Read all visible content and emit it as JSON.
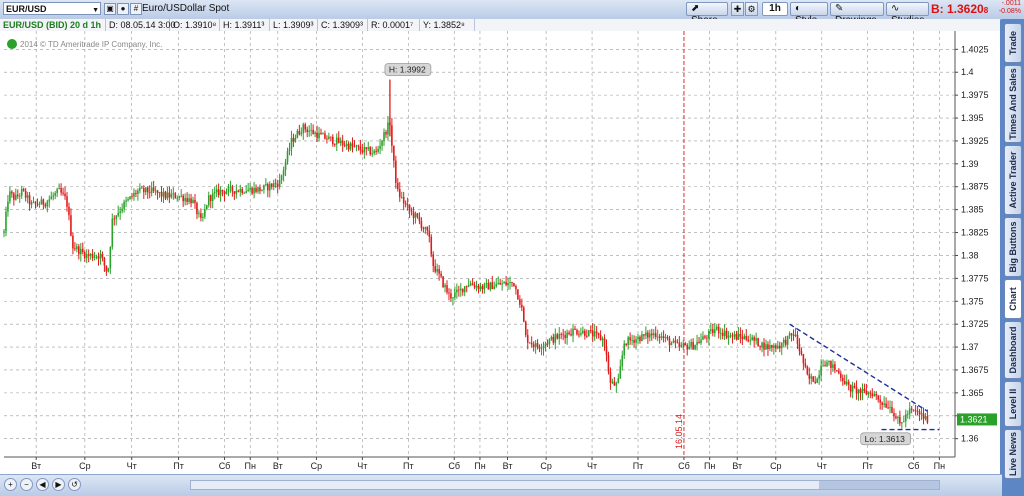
{
  "toolbar": {
    "symbol": "EUR/USD",
    "description": "Euro/USDollar Spot",
    "share_label": "Share",
    "timeframe_label": "1h",
    "style_label": "Style",
    "drawings_label": "Drawings",
    "studies_label": "Studies",
    "bid_label": "B: 1.3620",
    "bid_suffix": "8",
    "change_abs": "-.0011",
    "change_pct": "-0.08%"
  },
  "infobar": {
    "title": "EUR/USD (BID) 20 d 1h",
    "date": "D: 08.05.14 3:00",
    "open": "O: 1.3910⁸",
    "high": "H: 1.3911³",
    "low": "L: 1.3909³",
    "close": "C: 1.3909³",
    "range": "R: 0.0001⁷",
    "y": "Y: 1.3852⁸"
  },
  "sidebar": {
    "tabs": [
      "Trade",
      "Times And Sales",
      "Active Trader",
      "Big Buttons",
      "Chart",
      "Dashboard",
      "Level II",
      "Live News"
    ]
  },
  "colors": {
    "up": "#2aa12a",
    "down": "#e01b1b",
    "trend": "#1c2f9a",
    "grid": "#9a9a9a",
    "marker": "#e01b1b"
  },
  "chart_data": {
    "type": "candlestick",
    "title": "EUR/USD (BID) 20 d 1h",
    "copyright": "2014 © TD Ameritrade IP Company, Inc.",
    "ylim": [
      1.358,
      1.4045
    ],
    "y_ticks": [
      1.36,
      1.3625,
      1.365,
      1.3675,
      1.37,
      1.3725,
      1.375,
      1.3775,
      1.38,
      1.3825,
      1.385,
      1.3875,
      1.39,
      1.3925,
      1.395,
      1.3975,
      1.4,
      1.4025
    ],
    "y_tick_labels": [
      "1.36",
      "",
      "1.365",
      "1.3675",
      "1.37",
      "1.3725",
      "1.375",
      "1.3775",
      "1.38",
      "1.3825",
      "1.385",
      "1.3875",
      "1.39",
      "1.3925",
      "1.395",
      "1.3975",
      "1.4",
      "1.4025"
    ],
    "x_labels": [
      {
        "t": 0.035,
        "label": "Вт"
      },
      {
        "t": 0.088,
        "label": "Ср"
      },
      {
        "t": 0.139,
        "label": "Чт"
      },
      {
        "t": 0.19,
        "label": "Пт"
      },
      {
        "t": 0.24,
        "label": "Сб"
      },
      {
        "t": 0.268,
        "label": "Пн"
      },
      {
        "t": 0.298,
        "label": "Вт"
      },
      {
        "t": 0.34,
        "label": "Ср"
      },
      {
        "t": 0.39,
        "label": "Чт"
      },
      {
        "t": 0.44,
        "label": "Пт"
      },
      {
        "t": 0.49,
        "label": "Сб"
      },
      {
        "t": 0.518,
        "label": "Пн"
      },
      {
        "t": 0.548,
        "label": "Вт"
      },
      {
        "t": 0.59,
        "label": "Ср"
      },
      {
        "t": 0.64,
        "label": "Чт"
      },
      {
        "t": 0.69,
        "label": "Пт"
      },
      {
        "t": 0.74,
        "label": "Сб"
      },
      {
        "t": 0.768,
        "label": "Пн"
      },
      {
        "t": 0.798,
        "label": "Вт"
      },
      {
        "t": 0.84,
        "label": "Ср"
      },
      {
        "t": 0.89,
        "label": "Чт"
      },
      {
        "t": 0.94,
        "label": "Пт"
      },
      {
        "t": 0.99,
        "label": "Сб"
      },
      {
        "t": 1.018,
        "label": "Пн"
      }
    ],
    "session_marker": {
      "t": 0.74,
      "label": "16.05.14"
    },
    "high_label": "H: 1.3992",
    "low_label": "Lo: 1.3613",
    "last_price_label": "1.3621",
    "path": [
      [
        0.0,
        1.3825
      ],
      [
        0.005,
        1.3868
      ],
      [
        0.012,
        1.3862
      ],
      [
        0.02,
        1.387
      ],
      [
        0.03,
        1.3855
      ],
      [
        0.045,
        1.3858
      ],
      [
        0.06,
        1.387
      ],
      [
        0.068,
        1.386
      ],
      [
        0.075,
        1.381
      ],
      [
        0.09,
        1.38
      ],
      [
        0.105,
        1.38
      ],
      [
        0.113,
        1.378
      ],
      [
        0.118,
        1.384
      ],
      [
        0.13,
        1.3855
      ],
      [
        0.145,
        1.387
      ],
      [
        0.16,
        1.387
      ],
      [
        0.175,
        1.3865
      ],
      [
        0.19,
        1.3865
      ],
      [
        0.205,
        1.386
      ],
      [
        0.215,
        1.3835
      ],
      [
        0.222,
        1.3862
      ],
      [
        0.235,
        1.387
      ],
      [
        0.26,
        1.3872
      ],
      [
        0.28,
        1.3872
      ],
      [
        0.3,
        1.388
      ],
      [
        0.313,
        1.3925
      ],
      [
        0.325,
        1.394
      ],
      [
        0.345,
        1.393
      ],
      [
        0.36,
        1.3925
      ],
      [
        0.375,
        1.392
      ],
      [
        0.39,
        1.3915
      ],
      [
        0.405,
        1.3912
      ],
      [
        0.415,
        1.3935
      ],
      [
        0.42,
        1.3945
      ],
      [
        0.423,
        1.391
      ],
      [
        0.428,
        1.387
      ],
      [
        0.44,
        1.385
      ],
      [
        0.45,
        1.384
      ],
      [
        0.462,
        1.3822
      ],
      [
        0.467,
        1.379
      ],
      [
        0.475,
        1.3775
      ],
      [
        0.485,
        1.3755
      ],
      [
        0.495,
        1.376
      ],
      [
        0.505,
        1.377
      ],
      [
        0.52,
        1.3765
      ],
      [
        0.535,
        1.3768
      ],
      [
        0.555,
        1.377
      ],
      [
        0.563,
        1.3745
      ],
      [
        0.568,
        1.371
      ],
      [
        0.58,
        1.37
      ],
      [
        0.6,
        1.371
      ],
      [
        0.62,
        1.3718
      ],
      [
        0.638,
        1.3715
      ],
      [
        0.653,
        1.3708
      ],
      [
        0.66,
        1.366
      ],
      [
        0.668,
        1.3658
      ],
      [
        0.675,
        1.3705
      ],
      [
        0.69,
        1.371
      ],
      [
        0.71,
        1.3715
      ],
      [
        0.725,
        1.3705
      ],
      [
        0.735,
        1.37
      ],
      [
        0.75,
        1.3702
      ],
      [
        0.765,
        1.3712
      ],
      [
        0.775,
        1.372
      ],
      [
        0.79,
        1.3712
      ],
      [
        0.81,
        1.371
      ],
      [
        0.83,
        1.37
      ],
      [
        0.845,
        1.3702
      ],
      [
        0.86,
        1.3715
      ],
      [
        0.865,
        1.37
      ],
      [
        0.875,
        1.3665
      ],
      [
        0.885,
        1.3665
      ],
      [
        0.89,
        1.3685
      ],
      [
        0.9,
        1.368
      ],
      [
        0.91,
        1.367
      ],
      [
        0.92,
        1.3655
      ],
      [
        0.935,
        1.365
      ],
      [
        0.945,
        1.365
      ],
      [
        0.955,
        1.364
      ],
      [
        0.965,
        1.3635
      ],
      [
        0.975,
        1.3615
      ],
      [
        0.985,
        1.363
      ],
      [
        0.995,
        1.3628
      ],
      [
        1.005,
        1.362
      ]
    ],
    "trendlines": [
      {
        "t1": 0.855,
        "v1": 1.3725,
        "t2": 1.005,
        "v2": 1.363
      },
      {
        "t1": 0.955,
        "v1": 1.361,
        "t2": 1.018,
        "v2": 1.361
      }
    ]
  }
}
